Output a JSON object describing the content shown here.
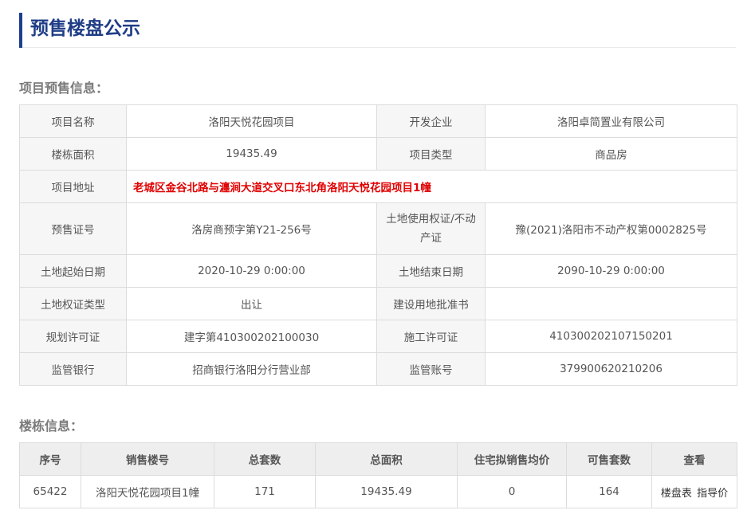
{
  "page_title": "预售楼盘公示",
  "project_section": {
    "title": "项目预售信息：",
    "rows": [
      {
        "l1": "项目名称",
        "v1": "洛阳天悦花园项目",
        "l2": "开发企业",
        "v2": "洛阳卓简置业有限公司"
      },
      {
        "l1": "楼栋面积",
        "v1": "19435.49",
        "l2": "项目类型",
        "v2": "商品房"
      },
      {
        "l1": "项目地址",
        "v1": "老城区金谷北路与瀍涧大道交叉口东北角洛阳天悦花园项目1幢"
      },
      {
        "l1": "预售证号",
        "v1": "洛房商预字第Y21-256号",
        "l2": "土地使用权证/不动产证",
        "v2": "豫(2021)洛阳市不动产权第0002825号"
      },
      {
        "l1": "土地起始日期",
        "v1": "2020-10-29 0:00:00",
        "l2": "土地结束日期",
        "v2": "2090-10-29 0:00:00"
      },
      {
        "l1": "土地权证类型",
        "v1": "出让",
        "l2": "建设用地批准书",
        "v2": ""
      },
      {
        "l1": "规划许可证",
        "v1": "建字第410300202100030",
        "l2": "施工许可证",
        "v2": "410300202107150201"
      },
      {
        "l1": "监管银行",
        "v1": "招商银行洛阳分行营业部",
        "l2": "监管账号",
        "v2": "379900620210206"
      }
    ]
  },
  "building_section": {
    "title": "楼栋信息：",
    "headers": [
      "序号",
      "销售楼号",
      "总套数",
      "总面积",
      "住宅拟销售均价",
      "可售套数",
      "查看"
    ],
    "rows": [
      {
        "no": "65422",
        "name": "洛阳天悦花园项目1幢",
        "total_units": "171",
        "total_area": "19435.49",
        "avg_price": "0",
        "available": "164",
        "link1": "楼盘表",
        "link2": "指导价"
      }
    ]
  }
}
